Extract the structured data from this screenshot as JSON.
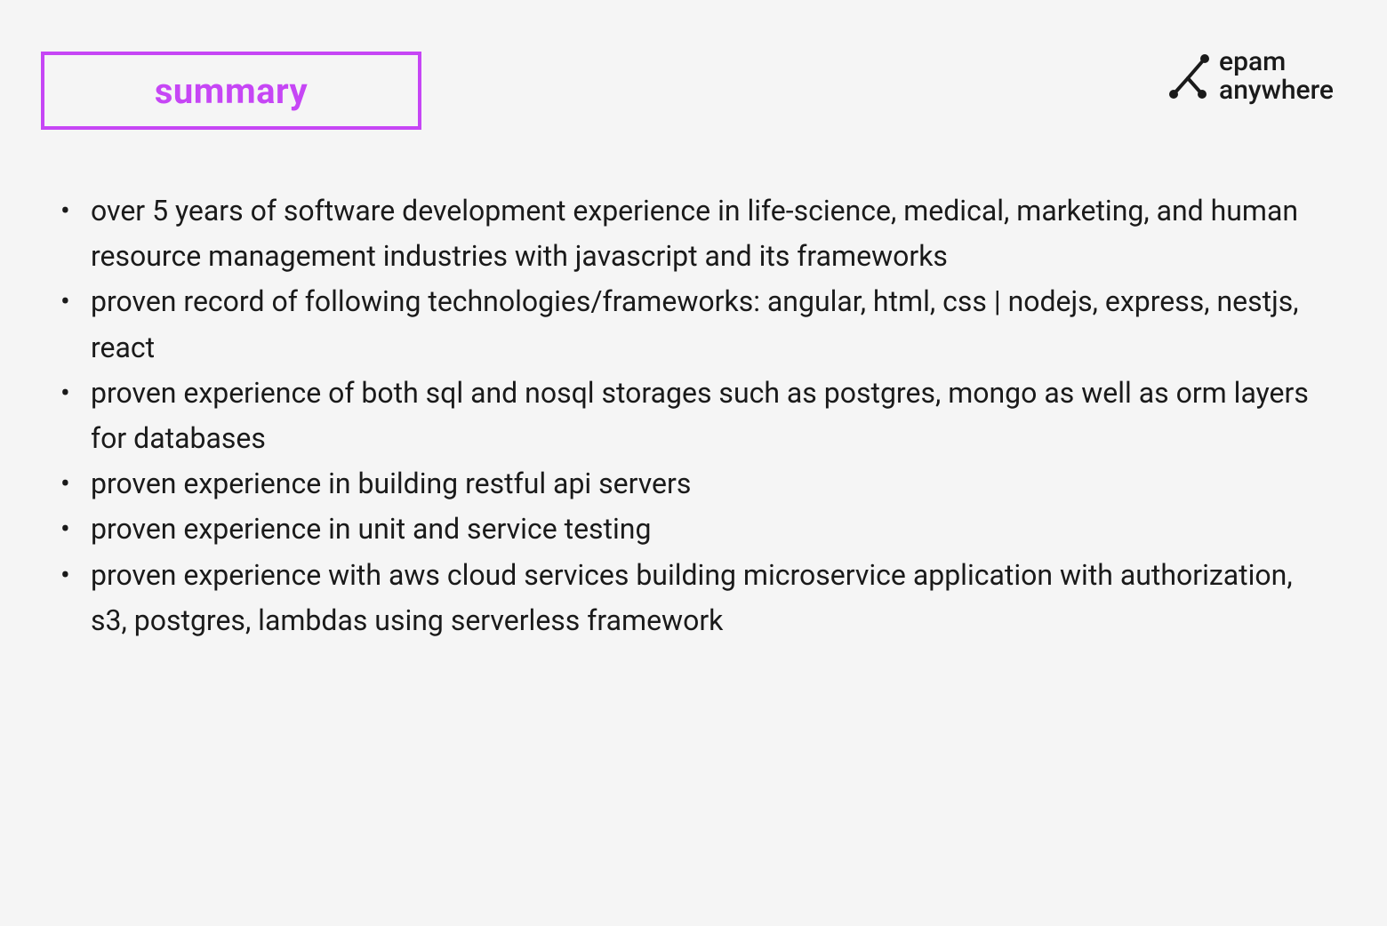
{
  "header": {
    "title": "summary"
  },
  "logo": {
    "line1": "epam",
    "line2": "anywhere"
  },
  "summary": {
    "items": [
      "over 5 years of software development experience in life-science, medical, marketing, and human resource management industries with javascript and its frameworks",
      "proven record of following technologies/frameworks: angular, html, css | nodejs, express, nestjs, react",
      "proven experience of both sql and nosql storages such as postgres, mongo as well as orm layers for databases",
      "proven experience in building restful api servers",
      "proven experience in unit and service testing",
      "proven experience with aws cloud services building microservice application with authorization, s3, postgres, lambdas using serverless framework"
    ]
  },
  "colors": {
    "accent": "#c646f5",
    "text": "#1a1a1a",
    "background": "#f5f5f5"
  }
}
